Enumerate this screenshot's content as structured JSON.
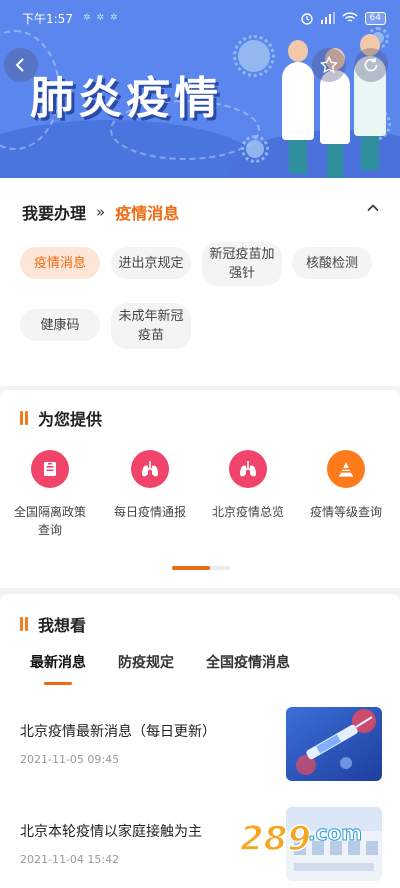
{
  "status_bar": {
    "time": "下午1:57",
    "battery": "64"
  },
  "banner": {
    "title": "肺炎疫情"
  },
  "handle": {
    "label": "我要办理",
    "current": "疫情消息",
    "tags": [
      {
        "label": "疫情消息",
        "selected": true
      },
      {
        "label": "进出京规定",
        "selected": false
      },
      {
        "label": "新冠疫苗加强针",
        "selected": false
      },
      {
        "label": "核酸检测",
        "selected": false
      },
      {
        "label": "健康码",
        "selected": false
      },
      {
        "label": "未成年新冠疫苗",
        "selected": false
      }
    ]
  },
  "provide": {
    "title": "为您提供",
    "services": [
      {
        "label": "全国隔离政策查询",
        "icon": "document-icon",
        "color": "#f0446a"
      },
      {
        "label": "每日疫情通报",
        "icon": "lungs-icon",
        "color": "#f0446a"
      },
      {
        "label": "北京疫情总览",
        "icon": "lungs-icon",
        "color": "#f0446a"
      },
      {
        "label": "疫情等级查询",
        "icon": "warning-cone-icon",
        "color": "#ff7a1a"
      }
    ],
    "page_progress": 0.65
  },
  "watch": {
    "title": "我想看",
    "tabs": [
      "最新消息",
      "防疫规定",
      "全国疫情消息"
    ],
    "active_tab": 0,
    "news": [
      {
        "title": "北京疫情最新消息（每日更新）",
        "date": "2021-11-05 09:45",
        "image": "vaccine-syringe"
      },
      {
        "title": "北京本轮疫情以家庭接触为主",
        "date": "2021-11-04 15:42",
        "image": "fever-poster"
      }
    ]
  },
  "watermark": {
    "text": "289.com"
  },
  "colors": {
    "accent": "#f06a12",
    "banner": "#5a86ee",
    "icon_red": "#f0446a",
    "icon_orange": "#ff7a1a"
  }
}
